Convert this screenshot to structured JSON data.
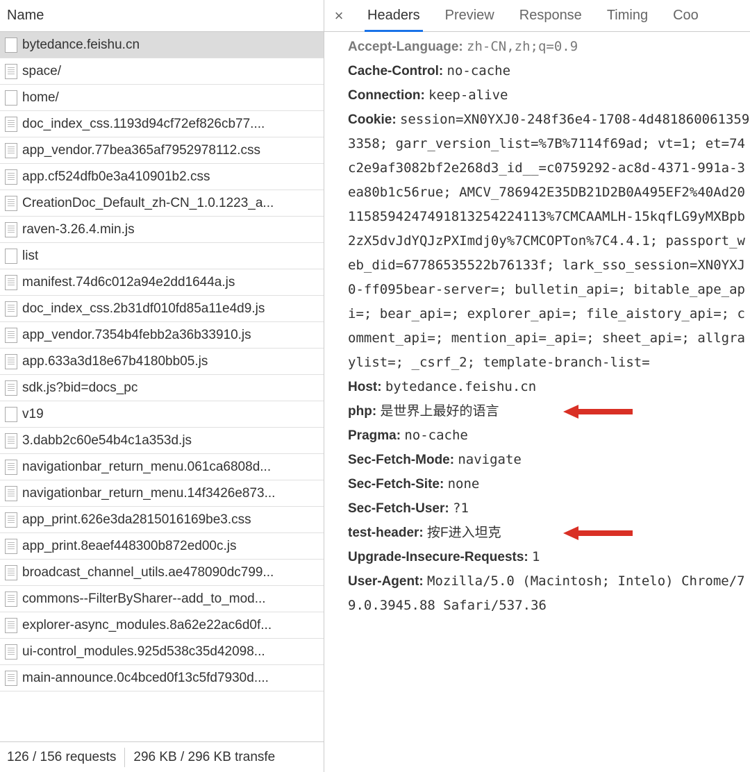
{
  "left": {
    "header": "Name",
    "requests": [
      {
        "name": "bytedance.feishu.cn",
        "icon": "empty",
        "selected": true
      },
      {
        "name": "space/",
        "icon": "doc"
      },
      {
        "name": "home/",
        "icon": "empty"
      },
      {
        "name": "doc_index_css.1193d94cf72ef826cb77....",
        "icon": "doc"
      },
      {
        "name": "app_vendor.77bea365af7952978112.css",
        "icon": "doc"
      },
      {
        "name": "app.cf524dfb0e3a410901b2.css",
        "icon": "doc"
      },
      {
        "name": "CreationDoc_Default_zh-CN_1.0.1223_a...",
        "icon": "doc"
      },
      {
        "name": "raven-3.26.4.min.js",
        "icon": "doc"
      },
      {
        "name": "list",
        "icon": "empty"
      },
      {
        "name": "manifest.74d6c012a94e2dd1644a.js",
        "icon": "doc"
      },
      {
        "name": "doc_index_css.2b31df010fd85a11e4d9.js",
        "icon": "doc"
      },
      {
        "name": "app_vendor.7354b4febb2a36b33910.js",
        "icon": "doc"
      },
      {
        "name": "app.633a3d18e67b4180bb05.js",
        "icon": "doc"
      },
      {
        "name": "sdk.js?bid=docs_pc",
        "icon": "doc"
      },
      {
        "name": "v19",
        "icon": "empty"
      },
      {
        "name": "3.dabb2c60e54b4c1a353d.js",
        "icon": "doc"
      },
      {
        "name": "navigationbar_return_menu.061ca6808d...",
        "icon": "doc"
      },
      {
        "name": "navigationbar_return_menu.14f3426e873...",
        "icon": "doc"
      },
      {
        "name": "app_print.626e3da2815016169be3.css",
        "icon": "doc"
      },
      {
        "name": "app_print.8eaef448300b872ed00c.js",
        "icon": "doc"
      },
      {
        "name": "broadcast_channel_utils.ae478090dc799...",
        "icon": "doc"
      },
      {
        "name": "commons--FilterBySharer--add_to_mod...",
        "icon": "doc"
      },
      {
        "name": "explorer-async_modules.8a62e22ac6d0f...",
        "icon": "doc"
      },
      {
        "name": "ui-control_modules.925d538c35d42098...",
        "icon": "doc"
      },
      {
        "name": "main-announce.0c4bced0f13c5fd7930d....",
        "icon": "doc"
      }
    ],
    "status": {
      "requests": "126 / 156 requests",
      "transfer": "296 KB / 296 KB transfe"
    }
  },
  "right": {
    "close": "×",
    "tabs": [
      {
        "label": "Headers",
        "active": true
      },
      {
        "label": "Preview",
        "active": false
      },
      {
        "label": "Response",
        "active": false
      },
      {
        "label": "Timing",
        "active": false
      },
      {
        "label": "Coo",
        "active": false
      }
    ],
    "headers": [
      {
        "key": "Accept-Language:",
        "val": "zh-CN,zh;q=0.9",
        "mono": true,
        "wrap": false,
        "faded": true
      },
      {
        "key": "Cache-Control:",
        "val": "no-cache",
        "mono": true
      },
      {
        "key": "Connection:",
        "val": "keep-alive",
        "mono": true
      },
      {
        "key": "Cookie:",
        "val": "session=XN0YXJ0-248f36e4-1708-4d4818600613593358; garr_version_list=%7B%7114f69ad; vt=1; et=74c2e9af3082bf2e268d3_id__=c0759292-ac8d-4371-991a-3ea80b1c56rue; AMCV_786942E35DB21D2B0A495EF2%40Ad20115859424749181325422411​3%7CMCAAMLH-15kqfLG9yMXBpb2zX5dvJdYQJzPXImdj0y%7CMCOPTon%7C4.4.1; passport_web_did=67786535522b76133f; lark_sso_session=XN0YXJ0-ff095bear-server=; bulletin_api=; bitable_ape_api=; bear_api=; explorer_api=; file_aistory_api=; comment_api=; mention_api=_api=; sheet_api=; allgraylist=; _csrf_2; template-branch-list=",
        "mono": true,
        "wrap": true
      },
      {
        "key": "Host:",
        "val": "bytedance.feishu.cn",
        "mono": true
      },
      {
        "key": "php:",
        "val": "是世界上最好的语言",
        "mono": false,
        "arrow": true
      },
      {
        "key": "Pragma:",
        "val": "no-cache",
        "mono": true
      },
      {
        "key": "Sec-Fetch-Mode:",
        "val": "navigate",
        "mono": true
      },
      {
        "key": "Sec-Fetch-Site:",
        "val": "none",
        "mono": true
      },
      {
        "key": "Sec-Fetch-User:",
        "val": "?1",
        "mono": true
      },
      {
        "key": "test-header:",
        "val": "按F进入坦克",
        "mono": false,
        "arrow": true
      },
      {
        "key": "Upgrade-Insecure-Requests:",
        "val": "1",
        "mono": true
      },
      {
        "key": "User-Agent:",
        "val": "Mozilla/5.0 (Macintosh; Intelo) Chrome/79.0.3945.88 Safari/537.36",
        "mono": true,
        "wrap": true
      }
    ]
  }
}
